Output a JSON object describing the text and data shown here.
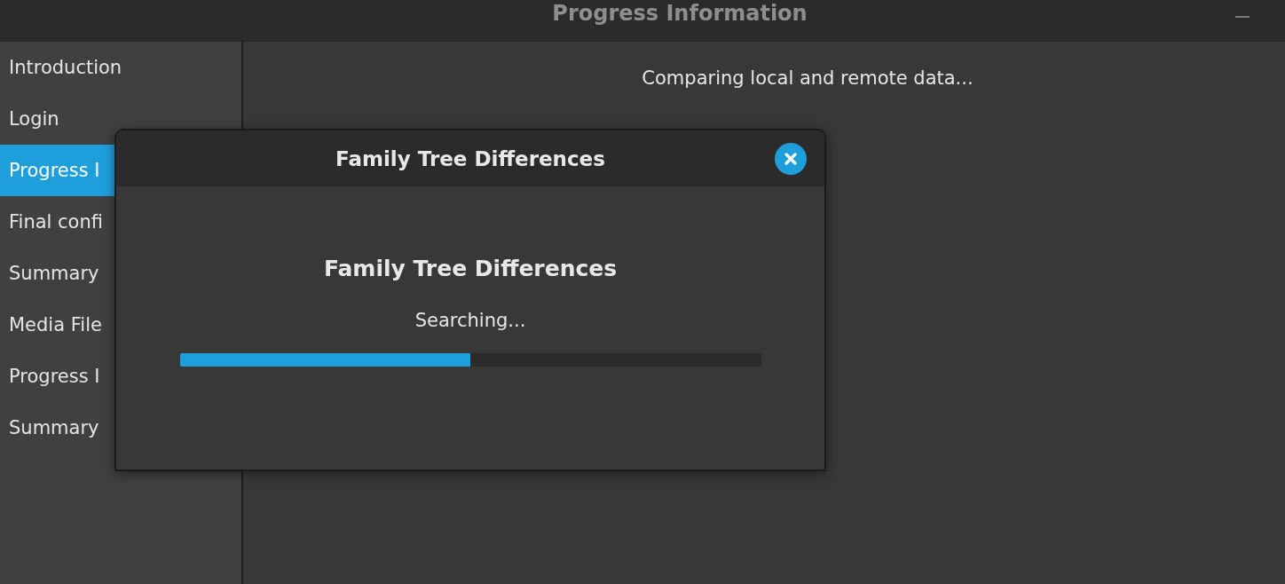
{
  "window": {
    "title": "Progress Information"
  },
  "sidebar": {
    "items": [
      {
        "label": "Introduction",
        "selected": false
      },
      {
        "label": "Login",
        "selected": false
      },
      {
        "label": "Progress I",
        "selected": true
      },
      {
        "label": "Final confi",
        "selected": false
      },
      {
        "label": "Summary",
        "selected": false
      },
      {
        "label": "Media File",
        "selected": false
      },
      {
        "label": "Progress I",
        "selected": false
      },
      {
        "label": "Summary",
        "selected": false
      }
    ]
  },
  "main": {
    "message": "Comparing local and remote data..."
  },
  "dialog": {
    "title": "Family Tree Differences",
    "heading": "Family Tree Differences",
    "status": "Searching...",
    "progress": {
      "level": 0.5
    }
  }
}
